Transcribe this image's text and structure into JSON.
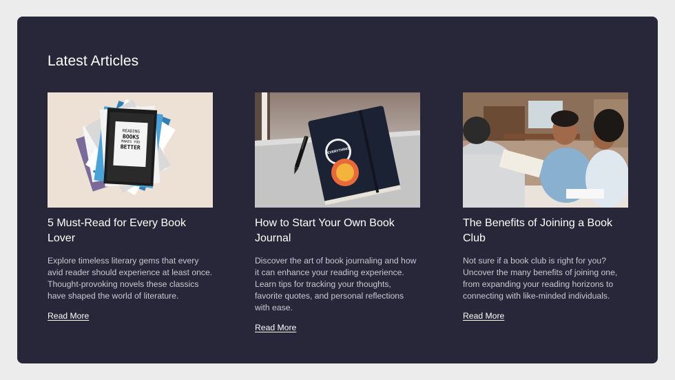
{
  "section": {
    "title": "Latest Articles"
  },
  "articles": [
    {
      "title": "5 Must-Read for Every Book Lover",
      "excerpt": "Explore timeless literary gems that every avid reader should experience at least once. Thought-provoking novels these classics have shaped the world of literature.",
      "link_label": "Read More",
      "image": {
        "name": "book-stack-image",
        "book_text": [
          "READING",
          "BOOKS",
          "MAKES YOU",
          "BETTER"
        ]
      }
    },
    {
      "title": "How to Start Your Own Book Journal",
      "excerpt": "Discover the art of book journaling and how it can enhance your reading experience. Learn tips for tracking your thoughts, favorite quotes, and personal reflections with ease.",
      "link_label": "Read More",
      "image": {
        "name": "journal-notebook-image",
        "sticker_text": "EVERYTHING"
      }
    },
    {
      "title": "The Benefits of Joining a Book Club",
      "excerpt": "Not sure if a book club is right for you? Uncover the many benefits of joining one, from expanding your reading horizons to connecting with like-minded individuals.",
      "link_label": "Read More",
      "image": {
        "name": "book-club-photo"
      }
    }
  ],
  "colors": {
    "page_bg": "#ececec",
    "panel_bg": "#272739",
    "heading": "#ffffff",
    "body_text": "#c9c9d2"
  }
}
